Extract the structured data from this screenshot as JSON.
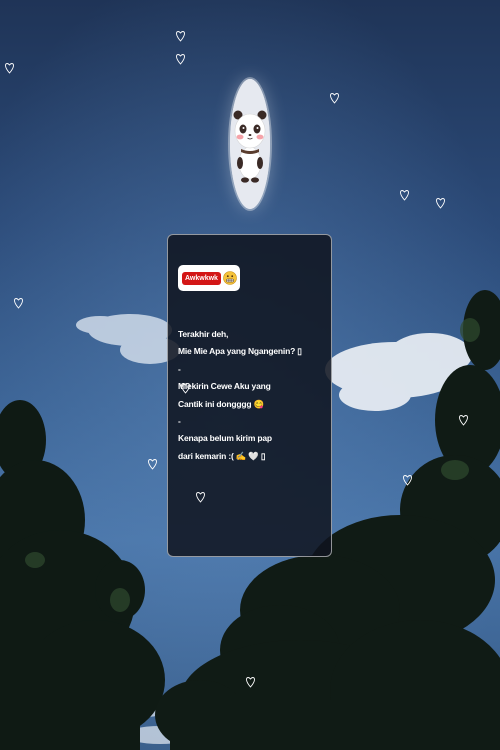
{
  "badge": {
    "label": "Awkwkwk",
    "emoji": "grimacing-face-icon"
  },
  "message": {
    "lines": [
      "Terakhir deh,",
      "Mie Mie Apa yang Ngangenin? ▯",
      "-",
      "Miekirin Cewe Aku yang",
      "Cantik ini dongggg 😋",
      "-",
      "Kenapa belum kirim pap",
      "dari kemarin :( ✍️ 🤍 ▯"
    ]
  },
  "colors": {
    "sky_top": "#1f3457",
    "sky_mid": "#4874a8",
    "card_bg": "#0f141e",
    "badge_red": "#d31616",
    "text": "#ffffff"
  }
}
